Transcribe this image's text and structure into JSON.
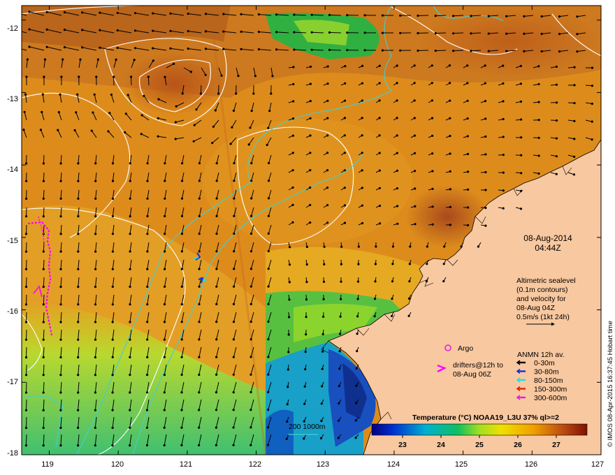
{
  "map": {
    "lon_ticks": [
      "119",
      "120",
      "121",
      "122",
      "123",
      "124",
      "125",
      "126",
      "127"
    ],
    "lat_ticks": [
      "-12",
      "-13",
      "-14",
      "-15",
      "-16",
      "-17",
      "-18"
    ],
    "lon_range": [
      118.6,
      127
    ],
    "lat_range": [
      -18,
      -11.8
    ]
  },
  "annotations": {
    "date": "08-Aug-2014",
    "time": "04:44Z",
    "altimetry_lines": [
      "Altimetric sealevel",
      "(0.1m contours)",
      "and velocity for",
      "08-Aug 04Z",
      "0.5m/s (1kt 24h)"
    ],
    "argo_label": "Argo",
    "drifters_lines": [
      "drifters@12h to",
      "08-Aug 06Z"
    ],
    "isobath_label": "200  1000m"
  },
  "legend": {
    "title": "ANMN 12h av.",
    "items": [
      {
        "label": "0-30m",
        "color": "#000000"
      },
      {
        "label": "30-80m",
        "color": "#1030e0"
      },
      {
        "label": "80-150m",
        "color": "#20e0e0"
      },
      {
        "label": "150-300m",
        "color": "#e02010"
      },
      {
        "label": "300-600m",
        "color": "#e020e0"
      }
    ]
  },
  "colorbar": {
    "title": "Temperature (°C) NOAA19_L3U 37% ql>=2",
    "ticks": [
      "23",
      "24",
      "25",
      "26",
      "27"
    ],
    "range": [
      22.2,
      27.8
    ]
  },
  "credit": "© IMOS 08-Apr-2015 16:37:45 Hobart time",
  "colors": {
    "land": "#f8c8a0",
    "isobath": "#40d0d0",
    "contour": "#ffffff",
    "drifter": "#ff00ff",
    "argo": "#e020e0"
  }
}
